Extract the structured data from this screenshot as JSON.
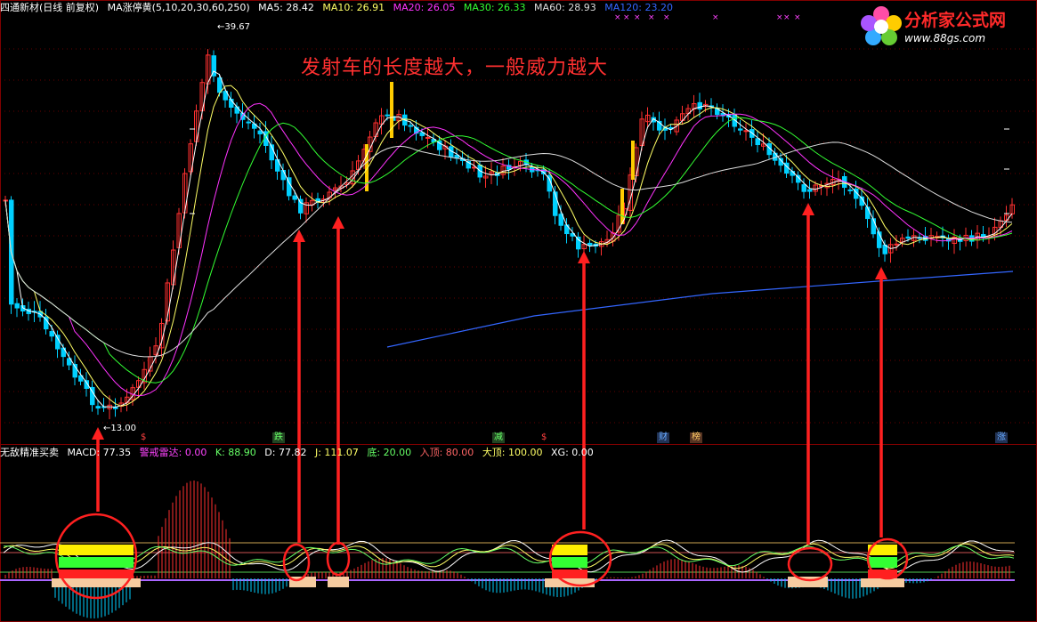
{
  "header": {
    "stock": "四通新材(日线 前复权)",
    "indicator": "MA涨停黄(5,10,20,30,60,250)",
    "ma": [
      {
        "label": "MA5: 28.42",
        "color": "#ffffff"
      },
      {
        "label": "MA10: 26.91",
        "color": "#ffff66"
      },
      {
        "label": "MA20: 26.05",
        "color": "#ff33ff"
      },
      {
        "label": "MA30: 26.33",
        "color": "#33ff33"
      },
      {
        "label": "MA60: 28.93",
        "color": "#dddddd"
      },
      {
        "label": "MA120: 23.20",
        "color": "#3366ff"
      }
    ]
  },
  "annotation": "发射车的长度越大，一般威力越大",
  "price_labels": {
    "high": "39.67",
    "low": "13.00"
  },
  "event_tags": [
    {
      "label": "跌",
      "color": "#66ff66",
      "bg": "#224422"
    },
    {
      "label": "减",
      "color": "#66ff66",
      "bg": "#224422"
    },
    {
      "label": "$",
      "color": "#ff4040",
      "bg": "transparent"
    },
    {
      "label": "$",
      "color": "#ff4040",
      "bg": "transparent"
    },
    {
      "label": "财",
      "color": "#66aaff",
      "bg": "#223355"
    },
    {
      "label": "榜",
      "color": "#ffcc66",
      "bg": "#553322"
    },
    {
      "label": "涨",
      "color": "#66aaff",
      "bg": "#223355"
    }
  ],
  "sub_header": {
    "name": "无敌精准买卖",
    "items": [
      {
        "label": "MACD: 77.35",
        "color": "#ffffff"
      },
      {
        "label": "警戒雷达: 0.00",
        "color": "#ff44ff"
      },
      {
        "label": "K: 88.90",
        "color": "#66ff66"
      },
      {
        "label": "D: 77.82",
        "color": "#ffffff"
      },
      {
        "label": "J: 111.07",
        "color": "#ffff66"
      },
      {
        "label": "底: 20.00",
        "color": "#66ff66"
      },
      {
        "label": "入顶: 80.00",
        "color": "#ff6666"
      },
      {
        "label": "大顶: 100.00",
        "color": "#ffff66"
      },
      {
        "label": "XG: 0.00",
        "color": "#ffffff"
      }
    ]
  },
  "logo": {
    "title": "分析家公式网",
    "url": "www.88gs.com"
  },
  "colors": {
    "up": "#ff3030",
    "down": "#00d0ff",
    "limit": "#ffcc00",
    "ma5": "#ffffff",
    "ma10": "#ffff66",
    "ma20": "#ff33ff",
    "ma30": "#33ff33",
    "ma60": "#dddddd",
    "ma120": "#3366ff",
    "arrow": "#ff2020",
    "grid": "#800000"
  }
}
